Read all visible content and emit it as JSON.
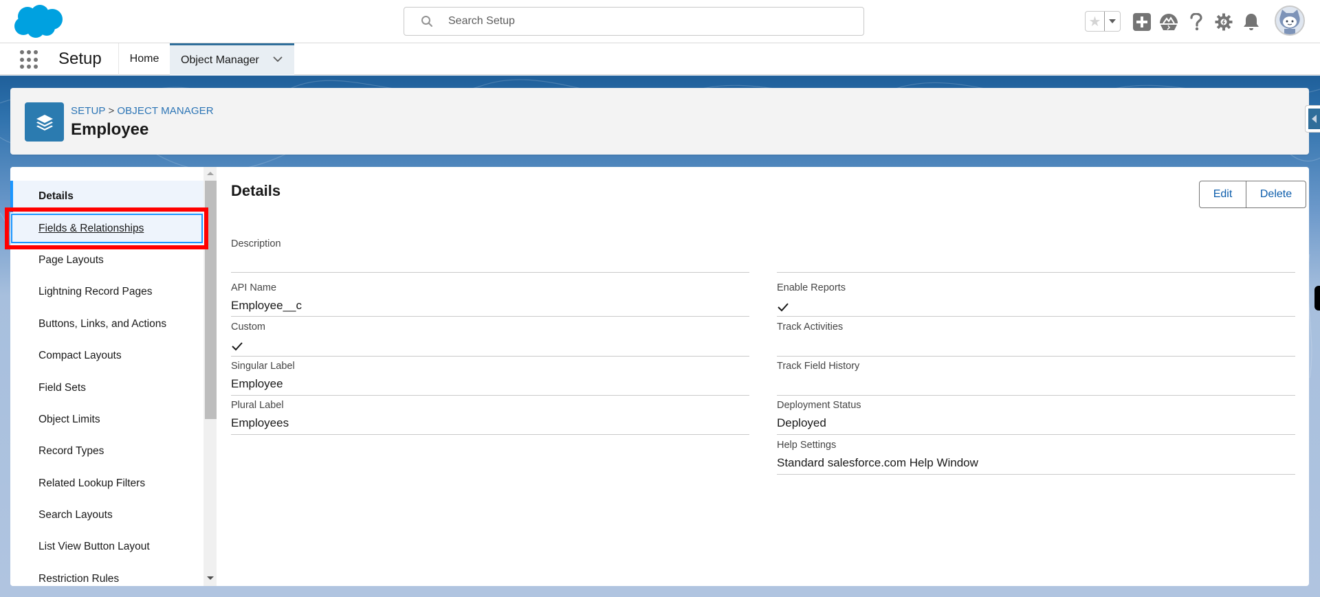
{
  "global_header": {
    "logo": "salesforce-cloud-logo",
    "search": {
      "placeholder": "Search Setup",
      "value": ""
    },
    "icons": [
      "favorites-star-icon",
      "favorites-dropdown-icon",
      "global-create-icon",
      "trailhead-icon",
      "help-icon",
      "setup-gear-icon",
      "notifications-bell-icon",
      "user-avatar"
    ]
  },
  "nav": {
    "app_name": "Setup",
    "tabs": [
      {
        "label": "Home",
        "active": false
      },
      {
        "label": "Object Manager",
        "active": true,
        "has_menu": true
      }
    ]
  },
  "object_header": {
    "breadcrumb": [
      "SETUP",
      "OBJECT MANAGER"
    ],
    "breadcrumb_separator": ">",
    "title": "Employee",
    "icon": "layers-icon"
  },
  "sidebar": {
    "items": [
      {
        "label": "Details",
        "state": "active"
      },
      {
        "label": "Fields & Relationships",
        "state": "focused"
      },
      {
        "label": "Page Layouts"
      },
      {
        "label": "Lightning Record Pages"
      },
      {
        "label": "Buttons, Links, and Actions"
      },
      {
        "label": "Compact Layouts"
      },
      {
        "label": "Field Sets"
      },
      {
        "label": "Object Limits"
      },
      {
        "label": "Record Types"
      },
      {
        "label": "Related Lookup Filters"
      },
      {
        "label": "Search Layouts"
      },
      {
        "label": "List View Button Layout"
      },
      {
        "label": "Restriction Rules"
      }
    ],
    "highlighted_item": "Fields & Relationships"
  },
  "details": {
    "title": "Details",
    "buttons": {
      "edit": "Edit",
      "delete": "Delete"
    },
    "left_fields": [
      {
        "label": "Description",
        "value": ""
      },
      {
        "label": "API Name",
        "value": "Employee__c"
      },
      {
        "label": "Custom",
        "value": "",
        "checked": true
      },
      {
        "label": "Singular Label",
        "value": "Employee"
      },
      {
        "label": "Plural Label",
        "value": "Employees"
      }
    ],
    "right_fields": [
      {
        "label": "Enable Reports",
        "value": "",
        "checked": true
      },
      {
        "label": "Track Activities",
        "value": "",
        "checked": false
      },
      {
        "label": "Track Field History",
        "value": "",
        "checked": false
      },
      {
        "label": "Deployment Status",
        "value": "Deployed"
      },
      {
        "label": "Help Settings",
        "value": "Standard salesforce.com Help Window"
      }
    ]
  },
  "colors": {
    "brand_blue": "#00a1e0",
    "link_blue": "#2b74b5",
    "button_text": "#0b5cab",
    "object_icon_bg": "#2b7bb0",
    "active_tab_border": "#2f6e9a",
    "highlight_red": "#ff0000",
    "focus_blue": "#1b96ff"
  }
}
